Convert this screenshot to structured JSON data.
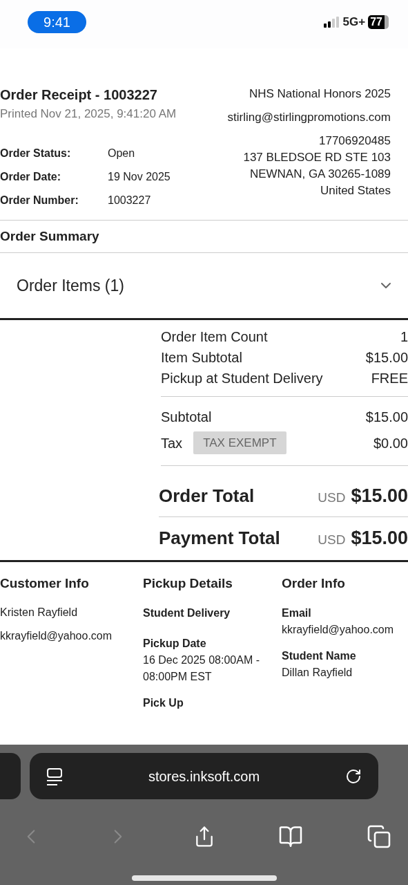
{
  "status_bar": {
    "time": "9:41",
    "network": "5G+",
    "battery": "77"
  },
  "receipt": {
    "title": "Order Receipt - 1003227",
    "printed": "Printed Nov 21, 2025, 9:41:20 AM",
    "fields": [
      {
        "label": "Order Status:",
        "value": "Open"
      },
      {
        "label": "Order Date:",
        "value": "19 Nov 2025"
      },
      {
        "label": "Order Number:",
        "value": "1003227"
      }
    ],
    "store": {
      "name": "NHS National Honors 2025",
      "email": "stirling@stirlingpromotions.com",
      "phone": "17706920485",
      "address_lines": [
        "137 BLEDSOE RD STE 103",
        "NEWNAN, GA 30265-1089",
        "United States"
      ]
    }
  },
  "summary": {
    "heading": "Order Summary",
    "items_section": {
      "label": "Order Items (1)",
      "expanded": false
    }
  },
  "totals": {
    "lines": [
      {
        "label": "Order Item Count",
        "value": "1"
      },
      {
        "label": "Item Subtotal",
        "value": "$15.00"
      },
      {
        "label": "Pickup at Student Delivery",
        "value": "FREE"
      }
    ],
    "subtotal_lines": [
      {
        "label": "Subtotal",
        "value": "$15.00"
      },
      {
        "label": "Tax",
        "badge": "TAX EXEMPT",
        "value": "$0.00"
      }
    ],
    "grand": [
      {
        "label": "Order Total",
        "currency": "USD",
        "value": "$15.00"
      },
      {
        "label": "Payment Total",
        "currency": "USD",
        "value": "$15.00"
      }
    ]
  },
  "info_columns": [
    {
      "heading": "Customer Info",
      "entries": [
        {
          "kind": "text",
          "text": "Kristen Rayfield"
        },
        {
          "kind": "text",
          "text": "kkrayfield@yahoo.com"
        }
      ]
    },
    {
      "heading": "Pickup Details",
      "entries": [
        {
          "kind": "label",
          "text": "Student Delivery"
        },
        {
          "kind": "label",
          "text": "Pickup Date"
        },
        {
          "kind": "value",
          "text": "16 Dec 2025 08:00AM - 08:00PM EST"
        },
        {
          "kind": "label",
          "text": "Pick Up"
        }
      ]
    },
    {
      "heading": "Order Info",
      "entries": [
        {
          "kind": "label",
          "text": "Email"
        },
        {
          "kind": "value",
          "text": "kkrayfield@yahoo.com"
        },
        {
          "kind": "label",
          "text": "Student Name"
        },
        {
          "kind": "value",
          "text": "Dillan Rayfield"
        }
      ]
    }
  ],
  "browser": {
    "url": "stores.inksoft.com"
  }
}
